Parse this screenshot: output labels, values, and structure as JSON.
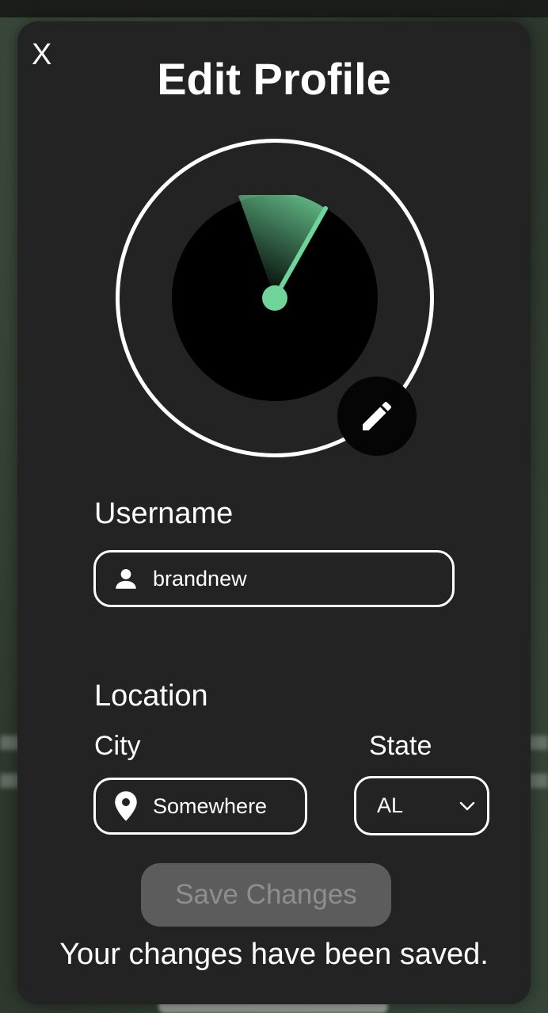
{
  "modal": {
    "close_label": "X",
    "title": "Edit Profile"
  },
  "avatar": {
    "icon": "radar-icon",
    "accent_color": "#6fd49a",
    "edit_icon": "pencil-icon"
  },
  "form": {
    "username_label": "Username",
    "username_value": "brandnew",
    "location_label": "Location",
    "city_label": "City",
    "city_value": "Somewhere",
    "state_label": "State",
    "state_value": "AL"
  },
  "actions": {
    "save_label": "Save Changes"
  },
  "status": {
    "message": "Your changes have been saved."
  }
}
